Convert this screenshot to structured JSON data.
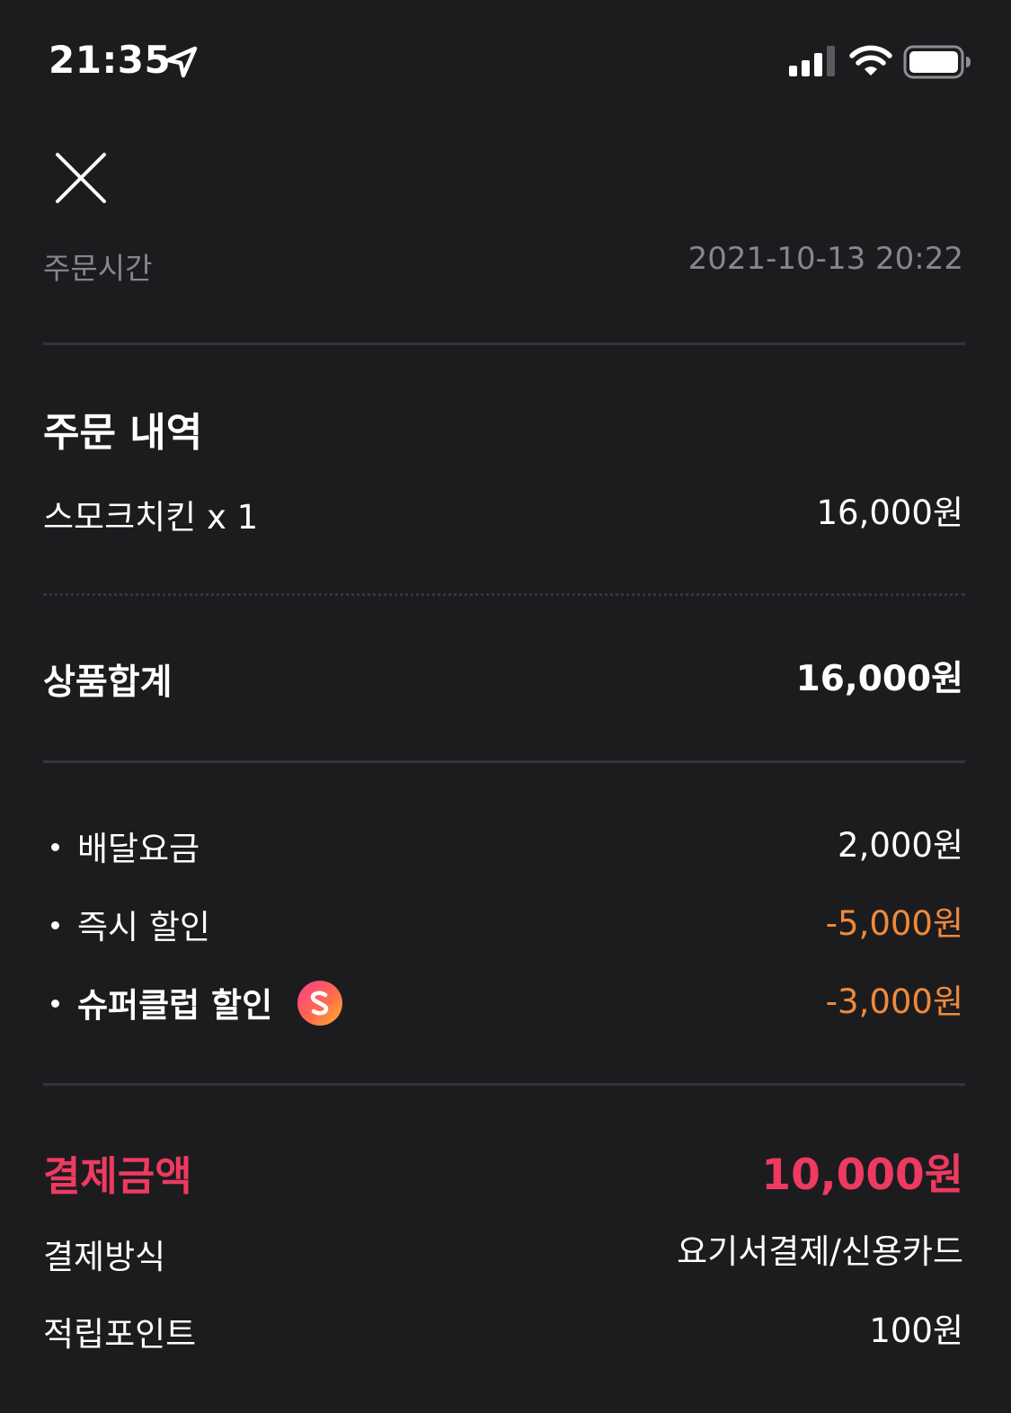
{
  "status_bar": {
    "time": "21:35"
  },
  "order_time": {
    "label": "주문시간",
    "value": "2021-10-13 20:22"
  },
  "order_details": {
    "title": "주문 내역",
    "items": [
      {
        "name": "스모크치킨 x 1",
        "price": "16,000원"
      }
    ]
  },
  "subtotal": {
    "label": "상품합계",
    "value": "16,000원"
  },
  "adjustments": [
    {
      "label": "배달요금",
      "value": "2,000원"
    },
    {
      "label": "즉시 할인",
      "value": "-5,000원"
    },
    {
      "label": "슈퍼클럽 할인",
      "value": "-3,000원",
      "badge_icon": "super-club-badge-icon"
    }
  ],
  "payment": {
    "total_label": "결제금액",
    "total_value": "10,000원",
    "method_label": "결제방식",
    "method_value": "요기서결제/신용카드",
    "points_label": "적립포인트",
    "points_value": "100원"
  },
  "colors": {
    "background": "#1c1c1f",
    "discount": "#f08a3a",
    "total": "#ee3a60",
    "muted": "#86868c"
  }
}
